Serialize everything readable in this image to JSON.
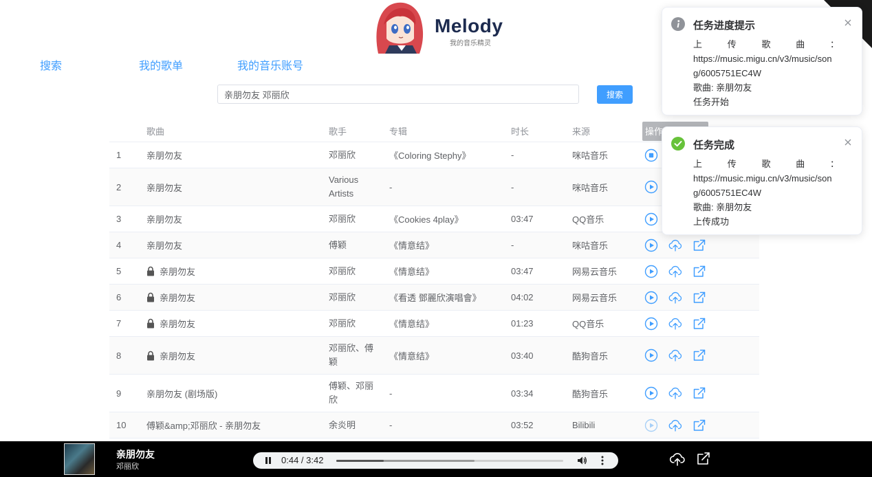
{
  "brand": {
    "name": "Melody",
    "tagline": "我的音乐精灵"
  },
  "nav": {
    "search": "搜索",
    "playlist": "我的歌单",
    "account": "我的音乐账号"
  },
  "search": {
    "value": "亲朋勿友 邓丽欣",
    "button": "搜索"
  },
  "table": {
    "headers": {
      "song": "歌曲",
      "artist": "歌手",
      "album": "专辑",
      "duration": "时长",
      "source": "来源",
      "ops": "操作"
    },
    "rows": [
      {
        "idx": "1",
        "song": "亲朋勿友",
        "locked": false,
        "artist": "邓丽欣",
        "album": "《Coloring Stephy》",
        "duration": "-",
        "source": "咪咕音乐",
        "state": "stop"
      },
      {
        "idx": "2",
        "song": "亲朋勿友",
        "locked": false,
        "artist": "Various Artists",
        "album": "-",
        "duration": "-",
        "source": "咪咕音乐",
        "state": "play"
      },
      {
        "idx": "3",
        "song": "亲朋勿友",
        "locked": false,
        "artist": "邓丽欣",
        "album": "《Cookies 4play》",
        "duration": "03:47",
        "source": "QQ音乐",
        "state": "play"
      },
      {
        "idx": "4",
        "song": "亲朋勿友",
        "locked": false,
        "artist": "傅颖",
        "album": "《情意结》",
        "duration": "-",
        "source": "咪咕音乐",
        "state": "play"
      },
      {
        "idx": "5",
        "song": "亲朋勿友",
        "locked": true,
        "artist": "邓丽欣",
        "album": "《情意结》",
        "duration": "03:47",
        "source": "网易云音乐",
        "state": "play"
      },
      {
        "idx": "6",
        "song": "亲朋勿友",
        "locked": true,
        "artist": "邓丽欣",
        "album": "《看透 鄧麗欣演唱會》",
        "duration": "04:02",
        "source": "网易云音乐",
        "state": "play"
      },
      {
        "idx": "7",
        "song": "亲朋勿友",
        "locked": true,
        "artist": "邓丽欣",
        "album": "《情意结》",
        "duration": "01:23",
        "source": "QQ音乐",
        "state": "play"
      },
      {
        "idx": "8",
        "song": "亲朋勿友",
        "locked": true,
        "artist": "邓丽欣、傅颖",
        "album": "《情意结》",
        "duration": "03:40",
        "source": "酷狗音乐",
        "state": "play"
      },
      {
        "idx": "9",
        "song": "亲朋勿友 (剧场版)",
        "locked": false,
        "artist": "傅颖、邓丽欣",
        "album": "-",
        "duration": "03:34",
        "source": "酷狗音乐",
        "state": "play"
      },
      {
        "idx": "10",
        "song": "傅颖&amp;邓丽欣 - 亲朋勿友",
        "locked": false,
        "artist": "余炎明",
        "album": "-",
        "duration": "03:52",
        "source": "Bilibili",
        "state": "disabled"
      }
    ]
  },
  "notices": [
    {
      "title": "任务进度提示",
      "type": "info",
      "prefix": [
        "上",
        "传",
        "歌",
        "曲",
        "："
      ],
      "url": "https://music.migu.cn/v3/music/song/6005751EC4W",
      "song_line": "歌曲: 亲朋勿友",
      "status": "任务开始"
    },
    {
      "title": "任务完成",
      "type": "success",
      "prefix": [
        "上",
        "传",
        "歌",
        "曲",
        "："
      ],
      "url": "https://music.migu.cn/v3/music/song/6005751EC4W",
      "song_line": "歌曲: 亲朋勿友",
      "status": "上传成功"
    }
  ],
  "player": {
    "title": "亲朋勿友",
    "artist": "邓丽欣",
    "time": "0:44 / 3:42",
    "progress": 0.21,
    "buffered": 0.61
  },
  "colors": {
    "accent": "#409eff",
    "success": "#67c23a",
    "info": "#909399",
    "player_bg": "#000000"
  }
}
